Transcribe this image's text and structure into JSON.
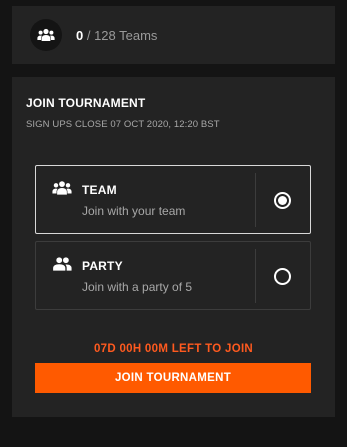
{
  "teams": {
    "count": "0",
    "total_label": " / 128 Teams",
    "icon": "team-icon"
  },
  "join": {
    "title": "JOIN TOURNAMENT",
    "subtitle": "SIGN UPS CLOSE 07 OCT 2020, 12:20 BST",
    "options": [
      {
        "title": "TEAM",
        "description": "Join with your team",
        "icon": "team-icon",
        "selected": true
      },
      {
        "title": "PARTY",
        "description": "Join with a party of 5",
        "icon": "party-icon",
        "selected": false
      }
    ],
    "countdown": "07D 00H 00M LEFT TO JOIN",
    "button_label": "JOIN TOURNAMENT"
  },
  "colors": {
    "accent": "#ff5a00",
    "background": "#141414",
    "card": "#232323"
  }
}
